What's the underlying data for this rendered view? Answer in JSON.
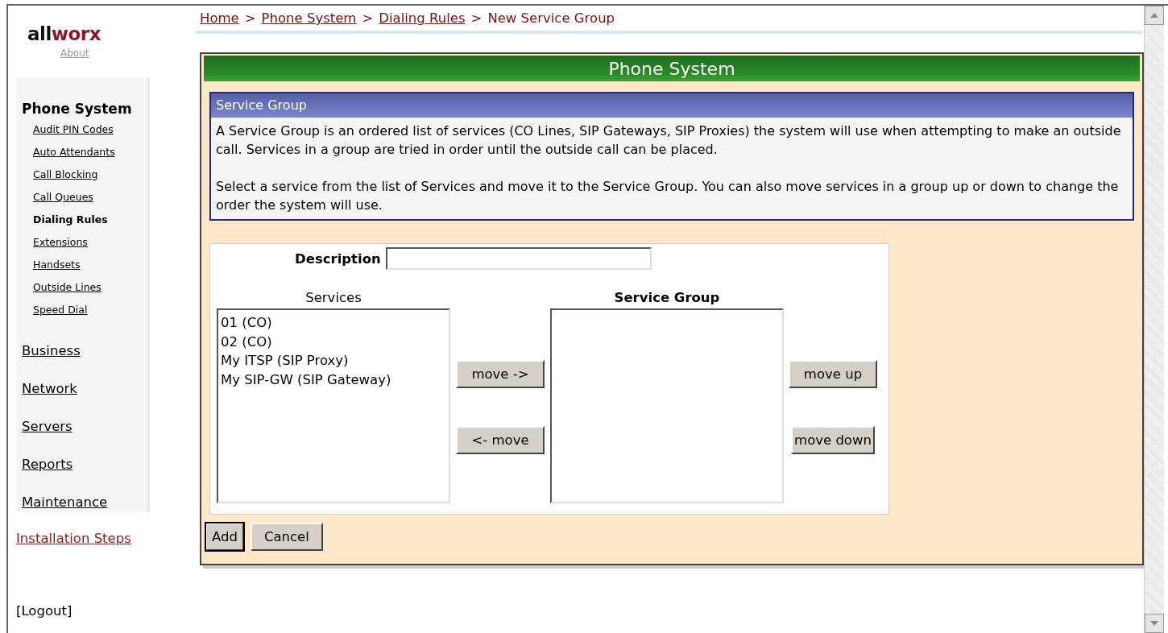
{
  "logo": {
    "part_1": "all",
    "part_2": "worx"
  },
  "about_link": "About",
  "sidebar": {
    "section_title": "Phone System",
    "items": [
      {
        "label": "Audit PIN Codes",
        "selected": false
      },
      {
        "label": "Auto Attendants",
        "selected": false
      },
      {
        "label": "Call Blocking",
        "selected": false
      },
      {
        "label": "Call Queues",
        "selected": false
      },
      {
        "label": "Dialing Rules",
        "selected": true
      },
      {
        "label": "Extensions",
        "selected": false
      },
      {
        "label": "Handsets",
        "selected": false
      },
      {
        "label": "Outside Lines",
        "selected": false
      },
      {
        "label": "Speed Dial",
        "selected": false
      }
    ],
    "sections": [
      "Business",
      "Network",
      "Servers",
      "Reports",
      "Maintenance"
    ]
  },
  "installation_link": "Installation Steps",
  "logout_link": "[Logout]",
  "breadcrumb": [
    {
      "label": "Home",
      "kind": "link"
    },
    {
      "label": ">",
      "kind": "separator"
    },
    {
      "label": "Phone System",
      "kind": "link"
    },
    {
      "label": ">",
      "kind": "separator"
    },
    {
      "label": "Dialing Rules",
      "kind": "link"
    },
    {
      "label": ">",
      "kind": "separator"
    },
    {
      "label": "New Service Group",
      "kind": "current"
    }
  ],
  "panel": {
    "title": "Phone System",
    "info_box": {
      "title": "Service Group",
      "paragraphs": [
        "A Service Group is an ordered list of services (CO Lines, SIP Gateways, SIP Proxies) the system will use when attempting to make an outside call. Services in a group are tried in order until the outside call can be placed.",
        "Select a service from the list of Services and move it to the Service Group. You can also move services in a group up or down to change the order the system will use."
      ]
    },
    "form": {
      "description_label": "Description",
      "services_label": "Services",
      "services": [
        "01 (CO)",
        "02 (CO)",
        "My ITSP (SIP Proxy)",
        "My SIP-GW (SIP Gateway)"
      ],
      "group_label": "Service Group",
      "move_right_button": "move ->",
      "move_left_button": "<- move",
      "move_up_button": "move up",
      "move_down_button": "move down"
    },
    "buttons": [
      {
        "label": "Add",
        "focused": true
      },
      {
        "label": "Cancel",
        "focused": false
      }
    ]
  }
}
